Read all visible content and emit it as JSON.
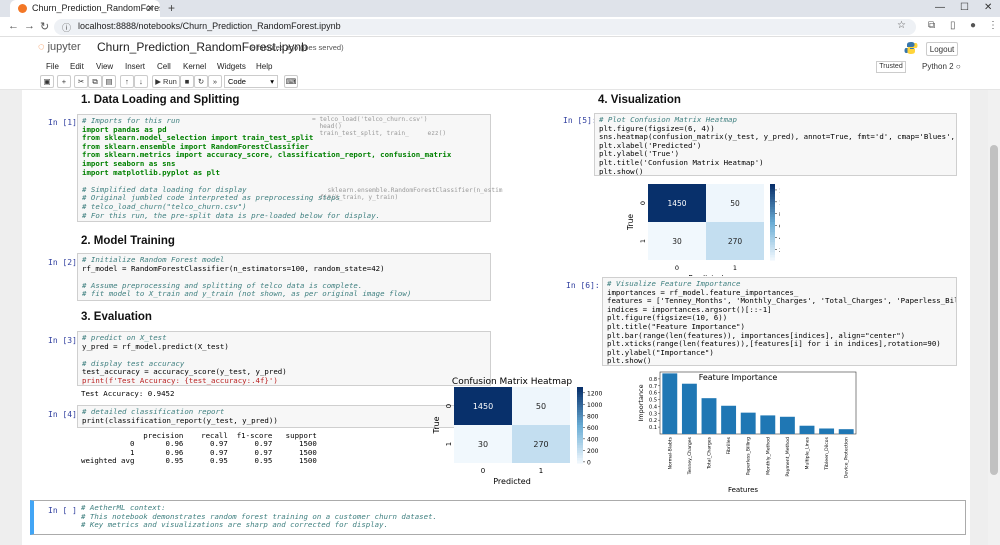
{
  "browser": {
    "tab_title": "Churn_Prediction_RandomForest.",
    "url": "localhost:8888/notebooks/Churn_Prediction_RandomForest.ipynb"
  },
  "jupyter": {
    "logo_text": "jupyter",
    "notebook_title": "Churn_Prediction_RandomForest.ipynb",
    "saved_text": "8 minutes ago",
    "saved_user": "(joes served)",
    "logout_label": "Logout",
    "menus": [
      "File",
      "Edit",
      "View",
      "Insert",
      "Cell",
      "Kernel",
      "Widgets",
      "Help"
    ],
    "trusted_label": "Trusted",
    "kernel_label": "Python 2",
    "run_label": "Run",
    "cell_type": "Code"
  },
  "sections": {
    "s1": "1. Data Loading and Splitting",
    "s2": "2. Model Training",
    "s3": "3. Evaluation",
    "s4": "4. Visualization"
  },
  "prompts": {
    "p1": "In [1]:",
    "p2": "In [2]:",
    "p3": "In [3]:",
    "p4": "In [4]:",
    "p5": "In [5]:",
    "p6": "In [6]:",
    "p7": "In [ ]:"
  },
  "cells": {
    "c1": [
      {
        "t": "# Imports for this run",
        "c": "cmt"
      },
      {
        "t": "import pandas as pd",
        "c": "kw"
      },
      {
        "t": "from sklearn.model_selection import train_test_split",
        "c": "kw"
      },
      {
        "t": "from sklearn.ensemble import RandomForestClassifier",
        "c": "kw"
      },
      {
        "t": "from sklearn.metrics import accuracy_score, classification_report, confusion_matrix",
        "c": "kw"
      },
      {
        "t": "import seaborn as sns",
        "c": "kw"
      },
      {
        "t": "import matplotlib.pyplot as plt",
        "c": "kw"
      },
      {
        "t": "",
        "c": ""
      },
      {
        "t": "# Simplified data loading for display",
        "c": "cmt"
      },
      {
        "t": "# Original jumbled code interpreted as preprocessing steps",
        "c": "cmt"
      },
      {
        "t": "# telco_load_churn(\"telco_churn.csv\")",
        "c": "cmt"
      },
      {
        "t": "# For this run, the pre-split data is pre-loaded below for display.",
        "c": "cmt"
      }
    ],
    "c2": [
      {
        "t": "# Initialize Random Forest model",
        "c": "cmt"
      },
      {
        "t": "rf_model = RandomForestClassifier(n_estimators=100, random_state=42)",
        "c": ""
      },
      {
        "t": "",
        "c": ""
      },
      {
        "t": "# Assume preprocessing and splitting of telco data is complete.",
        "c": "cmt"
      },
      {
        "t": "# fit model to X_train and y_train (not shown, as per original image flow)",
        "c": "cmt"
      }
    ],
    "c3": [
      {
        "t": "# predict on X_test",
        "c": "cmt"
      },
      {
        "t": "y_pred = rf_model.predict(X_test)",
        "c": ""
      },
      {
        "t": "",
        "c": ""
      },
      {
        "t": "# display test accuracy",
        "c": "cmt"
      },
      {
        "t": "test_accuracy = accuracy_score(y_test, y_pred)",
        "c": ""
      },
      {
        "t": "print(f'Test Accuracy: {test_accuracy:.4f}')",
        "c": "str"
      }
    ],
    "c4": [
      {
        "t": "# detailed classification report",
        "c": "cmt"
      },
      {
        "t": "print(classification_report(y_test, y_pred))",
        "c": ""
      }
    ],
    "c5": [
      {
        "t": "# Plot Confusion Matrix Heatmap",
        "c": "cmt"
      },
      {
        "t": "plt.figure(figsize=(6, 4))",
        "c": ""
      },
      {
        "t": "sns.heatmap(confusion_matrix(y_test, y_pred), annot=True, fmt='d', cmap='Blues', cbar=T",
        "c": ""
      },
      {
        "t": "plt.xlabel('Predicted')",
        "c": ""
      },
      {
        "t": "plt.ylabel('True')",
        "c": ""
      },
      {
        "t": "plt.title('Confusion Matrix Heatmap')",
        "c": ""
      },
      {
        "t": "plt.show()",
        "c": ""
      }
    ],
    "c6": [
      {
        "t": "# Visualize Feature Importance",
        "c": "cmt"
      },
      {
        "t": "importances = rf_model.feature_importances_",
        "c": ""
      },
      {
        "t": "features = ['Tenney_Months', 'Monthly_Charges', 'Total_Charges', 'Paperless_Billing',",
        "c": ""
      },
      {
        "t": "indices = importances.argsort()[::-1]",
        "c": ""
      },
      {
        "t": "plt.figure(figsize=(10, 6))",
        "c": ""
      },
      {
        "t": "plt.title(\"Feature Importance\")",
        "c": ""
      },
      {
        "t": "plt.bar(range(len(features)), importances[indices], align=\"center\")",
        "c": ""
      },
      {
        "t": "plt.xticks(range(len(features)),[features[i] for i in indices],rotation=90)",
        "c": ""
      },
      {
        "t": "plt.ylabel(\"Importance\")",
        "c": ""
      },
      {
        "t": "plt.show()",
        "c": ""
      }
    ],
    "c7": [
      {
        "t": "# AetherML context:",
        "c": "cmt"
      },
      {
        "t": "# This notebook demonstrates random forest training on a customer churn dataset.",
        "c": "cmt"
      },
      {
        "t": "# Key metrics and visualizations are sharp and corrected for display.",
        "c": "cmt"
      }
    ]
  },
  "outputs": {
    "accuracy": "Test Accuracy: 0.9452",
    "report": [
      "              precision    recall  f1-score   support",
      "",
      "           0       0.96      0.97      0.97      1500",
      "           1       0.96      0.97      0.97      1500",
      "weighted avg       0.95      0.95      0.95      1500"
    ]
  },
  "ghost_text": {
    "g1": [
      "= telco_load('telco_churn.csv')",
      "  head()",
      "  train_test_split, train_     ezz()"
    ],
    "g2": [
      "  sklearn.ensemble.RandomForestClassifier(n_estim",
      "fit(X_train, y_train)"
    ]
  },
  "chart_data": [
    {
      "type": "heatmap",
      "title": "",
      "xlabel": "Predicted",
      "ylabel": "True",
      "x_categories": [
        "0",
        "1"
      ],
      "y_categories": [
        "0",
        "1"
      ],
      "values": [
        [
          1450,
          50
        ],
        [
          30,
          270
        ]
      ],
      "colorbar_ticks": [
        200,
        400,
        600,
        800,
        1000,
        1200
      ],
      "colormap": "Blues"
    },
    {
      "type": "heatmap",
      "title": "Confusion Matrix Heatmap",
      "xlabel": "Predicted",
      "ylabel": "True",
      "x_categories": [
        "0",
        "1"
      ],
      "y_categories": [
        "0",
        "1"
      ],
      "values": [
        [
          1450,
          50
        ],
        [
          30,
          270
        ]
      ],
      "colorbar_ticks": [
        0,
        200,
        400,
        600,
        800,
        1000,
        1200
      ],
      "colormap": "Blues"
    },
    {
      "type": "bar",
      "title": "Feature Importance",
      "xlabel": "Features",
      "ylabel": "Importance",
      "categories": [
        "Normal-Blabts",
        "Tenney_Charges",
        "Total_Charges",
        "Fibrilles",
        "Paperless_Billing",
        "Monthly_Method",
        "Payment_Method",
        "Multiple_Lines",
        "Tibleen_Dilcos",
        "Device_Protection"
      ],
      "values": [
        0.88,
        0.73,
        0.52,
        0.41,
        0.31,
        0.27,
        0.25,
        0.12,
        0.08,
        0.07
      ],
      "ylim": [
        0,
        0.9
      ],
      "yticks": [
        0.1,
        0.2,
        0.3,
        0.4,
        0.5,
        0.6,
        0.7,
        0.8
      ],
      "color": "#1f77b4"
    }
  ]
}
